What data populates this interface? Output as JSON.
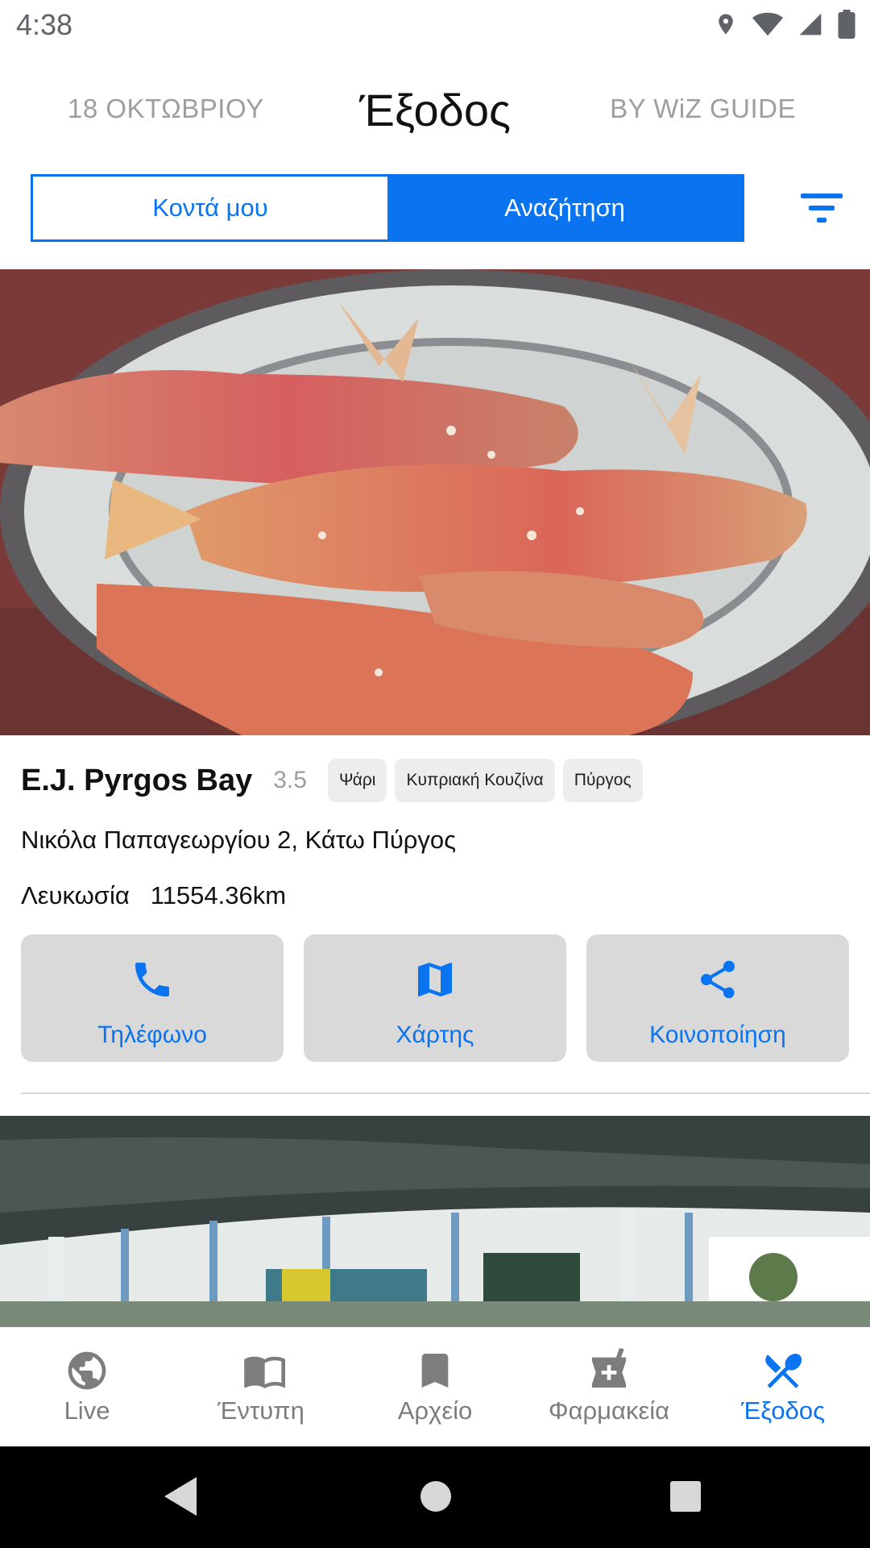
{
  "status_bar": {
    "time": "4:38"
  },
  "header": {
    "date": "18 ΟΚΤΩΒΡΙΟΥ",
    "title": "Έξοδος",
    "brand": "BY WiZ GUIDE"
  },
  "segment": {
    "near_label": "Κοντά μου",
    "search_label": "Αναζήτηση",
    "selected": "search"
  },
  "venues": [
    {
      "name": "E.J. Pyrgos Bay",
      "rating": "3.5",
      "tags": [
        "Ψάρι",
        "Κυπριακή Κουζίνα",
        "Πύργος"
      ],
      "address": "Νικόλα Παπαγεωργίου 2, Κάτω Πύργος",
      "city": "Λευκωσία",
      "distance": "11554.36km",
      "actions": {
        "phone": "Τηλέφωνο",
        "map": "Χάρτης",
        "share": "Κοινοποίηση"
      }
    }
  ],
  "bottom_nav": {
    "items": [
      {
        "label": "Live",
        "icon": "globe-icon"
      },
      {
        "label": "Έντυπη",
        "icon": "book-icon"
      },
      {
        "label": "Αρχείο",
        "icon": "bookmark-icon"
      },
      {
        "label": "Φαρμακεία",
        "icon": "pharmacy-icon"
      },
      {
        "label": "Έξοδος",
        "icon": "restaurant-icon"
      }
    ],
    "active": 4
  },
  "colors": {
    "accent": "#0a74f0",
    "muted": "#9e9e9e",
    "button_bg": "#d9d9d9"
  }
}
